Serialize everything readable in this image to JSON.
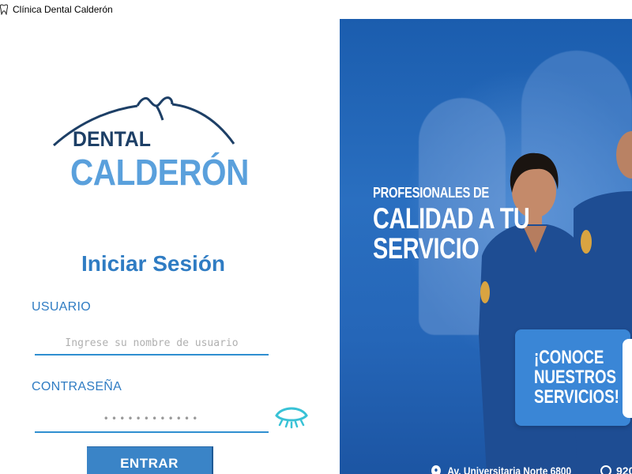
{
  "window": {
    "title": "Clínica Dental Calderón",
    "app_icon": "tooth-icon"
  },
  "login": {
    "logo": {
      "line1": "DENTAL",
      "line2": "CALDERÓN",
      "colors": {
        "line1": "#1d3f66",
        "line2": "#5aa0dc"
      }
    },
    "title": "Iniciar Sesión",
    "username": {
      "label": "USUARIO",
      "placeholder": "Ingrese su nombre de usuario",
      "value": ""
    },
    "password": {
      "label": "CONTRASEÑA",
      "value": "••••••••••••",
      "toggle_icon": "eye-icon"
    },
    "submit_label": "ENTRAR",
    "accent_color": "#2f7cc3"
  },
  "promo": {
    "headline_small": "PROFESIONALES DE",
    "headline_line1": "CALIDAD A TU",
    "headline_line2": "SERVICIO",
    "cta": "¡CONOCE NUESTROS SERVICIOS!",
    "address": "Av. Universitaria Norte 6800",
    "phone": "920",
    "background_color": "#1b5dae"
  }
}
